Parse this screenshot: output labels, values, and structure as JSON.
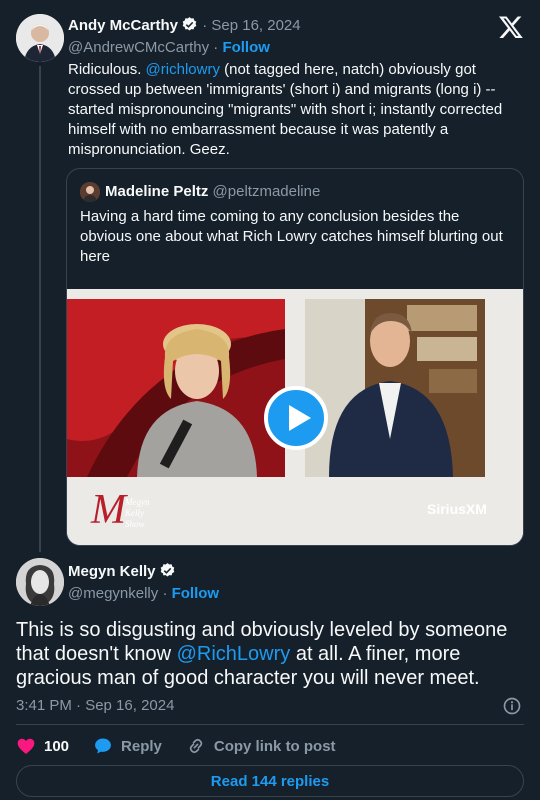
{
  "brand_colors": {
    "background": "#15202b",
    "link": "#1d9bf0",
    "muted": "#8b98a5",
    "like": "#f91880"
  },
  "parent_tweet": {
    "author_name": "Andy McCarthy",
    "separator": "·",
    "date": "Sep 16, 2024",
    "handle": "@AndrewCMcCarthy",
    "follow_label": "Follow",
    "text_before_mention": "Ridiculous. ",
    "mention": "@richlowry",
    "text_after_mention": " (not tagged here, natch) obviously got crossed up between 'immigrants' (short i) and migrants (long i) -- started mispronouncing \"migrants\" with short i; instantly corrected himself with no embarrassment because it was patently a mispronunciation. Geez."
  },
  "quoted_tweet": {
    "author_name": "Madeline Peltz",
    "handle": "@peltzmadeline",
    "text": "Having a hard time coming to any conclusion besides the obvious one about what Rich Lowry catches himself blurting out here",
    "media": {
      "watermark_left": "Megyn Kelly Show",
      "watermark_right": "SiriusXM"
    }
  },
  "main_tweet": {
    "author_name": "Megyn Kelly",
    "handle": "@megynkelly",
    "separator": "·",
    "follow_label": "Follow",
    "text_before_mention": "This is so disgusting and obviously leveled by someone that doesn't know ",
    "mention": "@RichLowry",
    "text_after_mention": " at all. A finer, more gracious man of good character you will never meet.",
    "timestamp": "3:41 PM · Sep 16, 2024"
  },
  "actions": {
    "like_count": "100",
    "reply_label": "Reply",
    "copy_link_label": "Copy link to post"
  },
  "read_replies_label": "Read 144 replies",
  "icons": [
    "x-logo-icon",
    "verified-badge-icon",
    "play-icon",
    "info-icon",
    "heart-icon",
    "reply-icon",
    "link-icon"
  ]
}
